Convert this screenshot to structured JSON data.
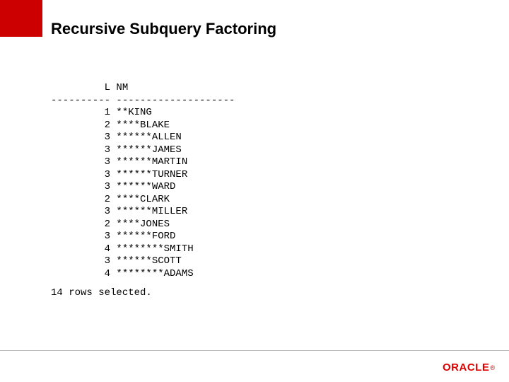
{
  "title": "Recursive Subquery Factoring",
  "columns": {
    "header_l": "L",
    "header_nm": "NM"
  },
  "rows": [
    {
      "l": 1,
      "nm": "**KING"
    },
    {
      "l": 2,
      "nm": "****BLAKE"
    },
    {
      "l": 3,
      "nm": "******ALLEN"
    },
    {
      "l": 3,
      "nm": "******JAMES"
    },
    {
      "l": 3,
      "nm": "******MARTIN"
    },
    {
      "l": 3,
      "nm": "******TURNER"
    },
    {
      "l": 3,
      "nm": "******WARD"
    },
    {
      "l": 2,
      "nm": "****CLARK"
    },
    {
      "l": 3,
      "nm": "******MILLER"
    },
    {
      "l": 2,
      "nm": "****JONES"
    },
    {
      "l": 3,
      "nm": "******FORD"
    },
    {
      "l": 4,
      "nm": "********SMITH"
    },
    {
      "l": 3,
      "nm": "******SCOTT"
    },
    {
      "l": 4,
      "nm": "********ADAMS"
    }
  ],
  "status": "14 rows selected.",
  "logo": "ORACLE",
  "chart_data": {
    "type": "table",
    "title": "Recursive Subquery Factoring",
    "columns": [
      "L",
      "NM"
    ],
    "rows": [
      [
        1,
        "**KING"
      ],
      [
        2,
        "****BLAKE"
      ],
      [
        3,
        "******ALLEN"
      ],
      [
        3,
        "******JAMES"
      ],
      [
        3,
        "******MARTIN"
      ],
      [
        3,
        "******TURNER"
      ],
      [
        3,
        "******WARD"
      ],
      [
        2,
        "****CLARK"
      ],
      [
        3,
        "******MILLER"
      ],
      [
        2,
        "****JONES"
      ],
      [
        3,
        "******FORD"
      ],
      [
        4,
        "********SMITH"
      ],
      [
        3,
        "******SCOTT"
      ],
      [
        4,
        "********ADAMS"
      ]
    ],
    "footer": "14 rows selected."
  }
}
